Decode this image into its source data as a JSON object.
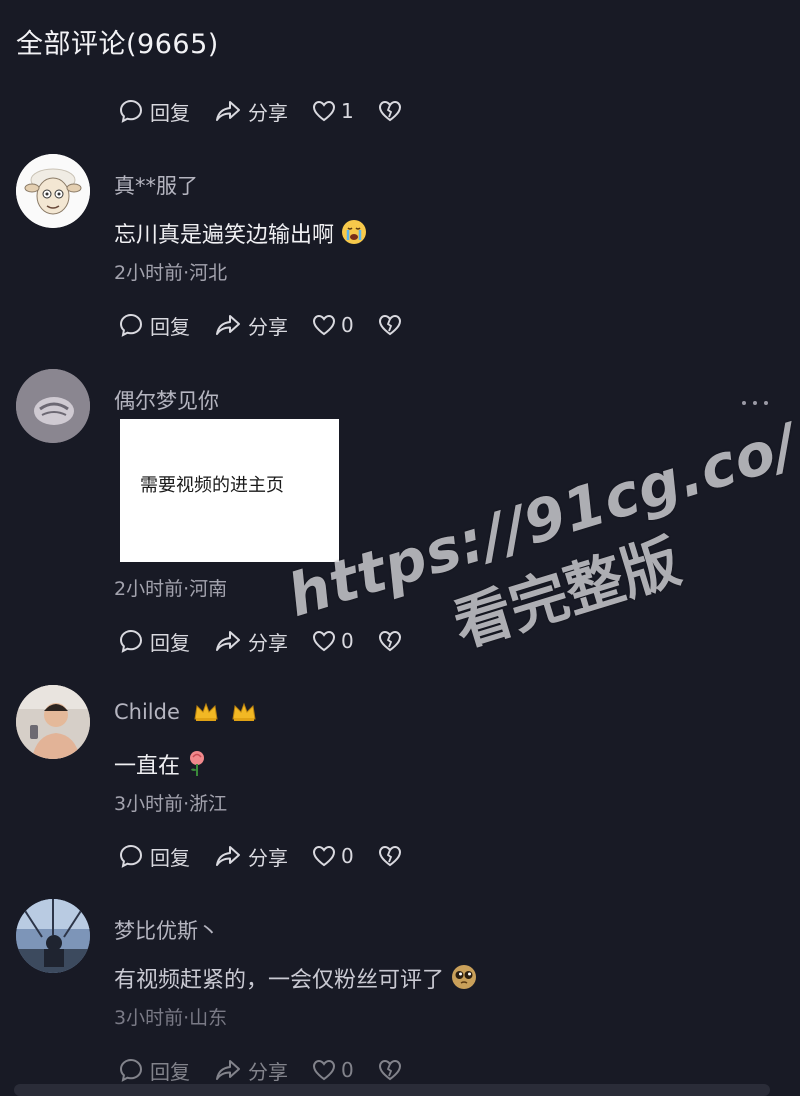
{
  "header": {
    "title": "全部评论(9665)"
  },
  "actions": {
    "reply": "回复",
    "share": "分享"
  },
  "top_actions": {
    "likes": "1"
  },
  "comments": [
    {
      "username": "真**服了",
      "text": "忘川真是遍笑边输出啊",
      "emoji_icon": "loudly-crying-face",
      "meta": "2小时前·河北",
      "likes": "0"
    },
    {
      "username": "偶尔梦见你",
      "image_text": "需要视频的进主页",
      "meta": "2小时前·河南",
      "likes": "0"
    },
    {
      "username": "Childe",
      "username_icons": [
        "crown-icon",
        "crown-icon"
      ],
      "text": "一直在",
      "emoji_icon": "rose",
      "meta": "3小时前·浙江",
      "likes": "0"
    },
    {
      "username": "梦比优斯丶",
      "text": "有视频赶紧的，一会仅粉丝可评了",
      "emoji_icon": "pleading-face",
      "meta": "3小时前·山东",
      "likes": "0"
    }
  ],
  "watermark": {
    "url": "https://91cg.co/",
    "tagline": "看完整版"
  },
  "colors": {
    "background": "#181a25",
    "text": "#f0f0f3",
    "muted": "#a3a3ae"
  }
}
